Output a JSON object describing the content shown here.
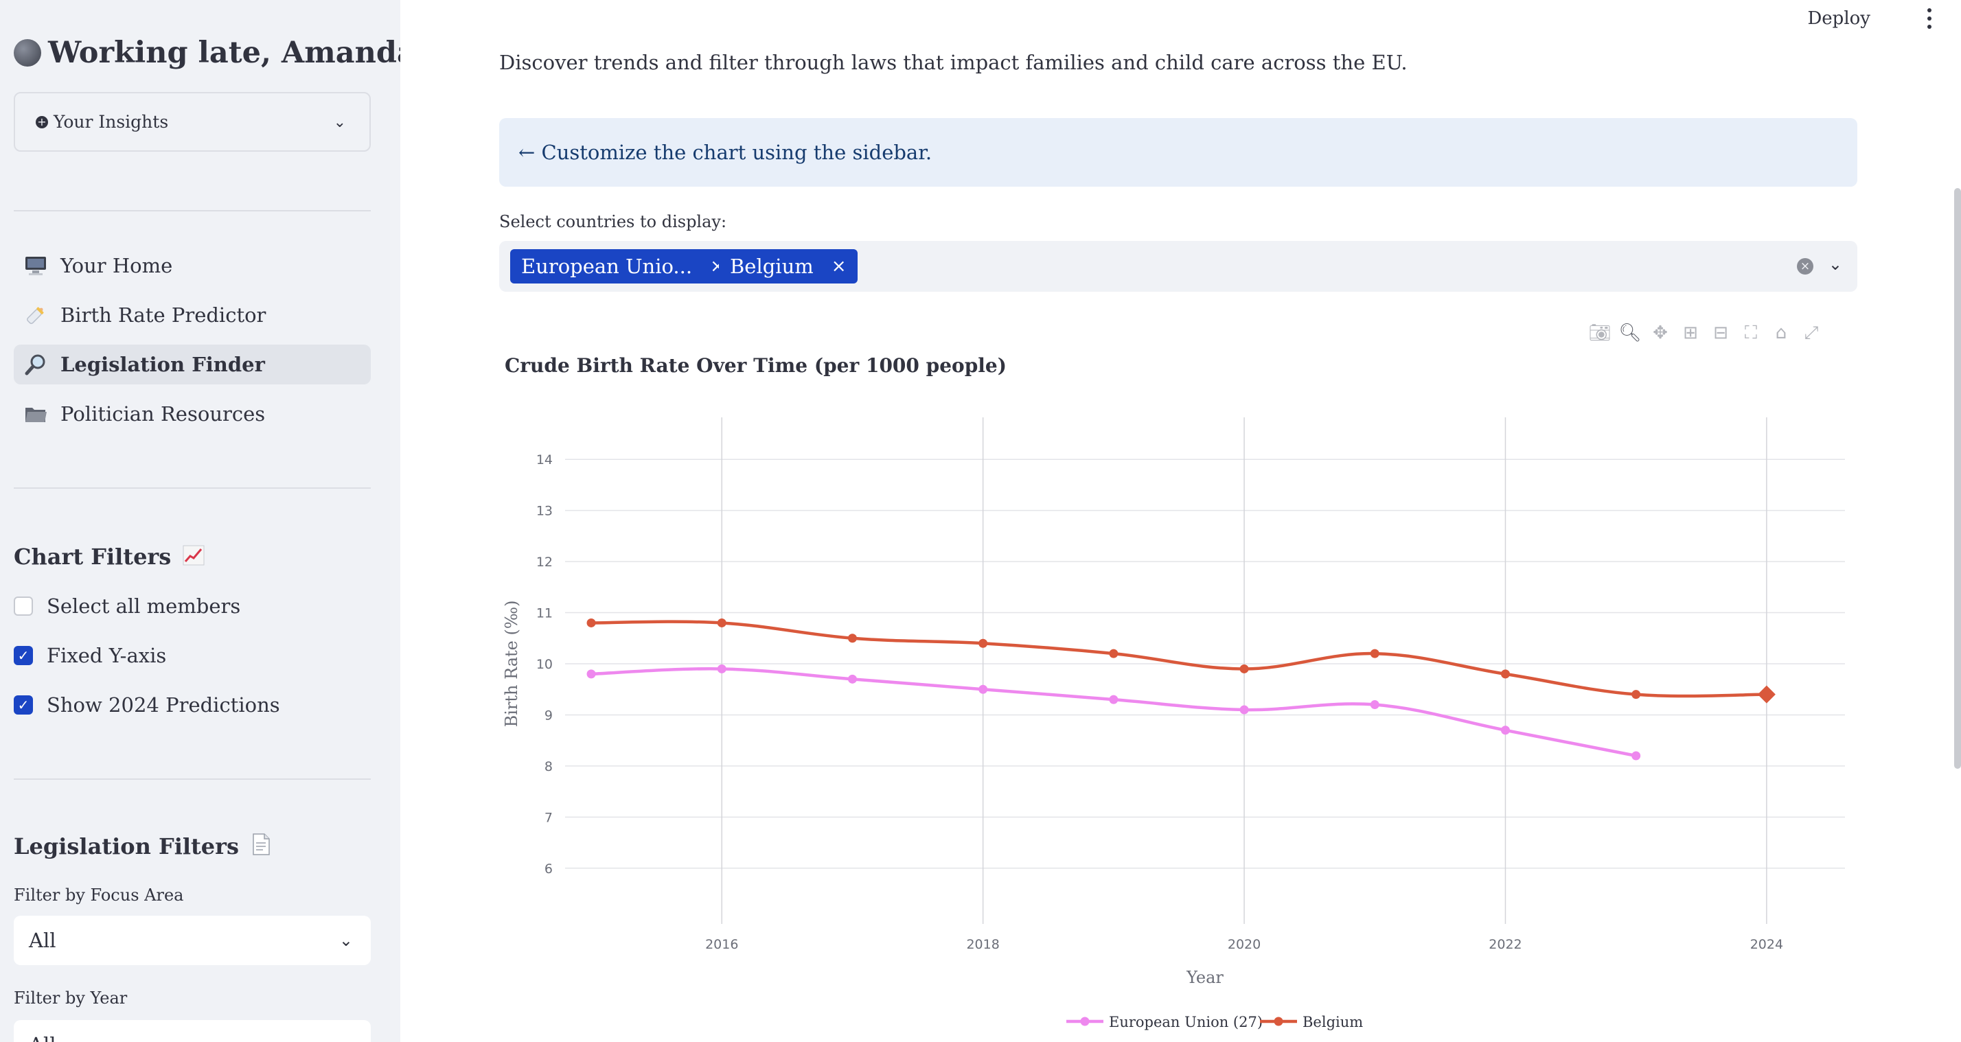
{
  "sidebar": {
    "greeting": "Working late, Amanda!",
    "insights_label": "Your Insights",
    "nav": [
      {
        "label": "Your Home",
        "icon": "monitor-icon",
        "active": false
      },
      {
        "label": "Birth Rate Predictor",
        "icon": "baby-bottle-icon",
        "active": false
      },
      {
        "label": "Legislation Finder",
        "icon": "magnifier-icon",
        "active": true
      },
      {
        "label": "Politician Resources",
        "icon": "folder-icon",
        "active": false
      }
    ],
    "chart_filters": {
      "title": "Chart Filters",
      "select_all": {
        "label": "Select all members",
        "checked": false
      },
      "fixed_y": {
        "label": "Fixed Y-axis",
        "checked": true
      },
      "show_predictions": {
        "label": "Show 2024 Predictions",
        "checked": true
      }
    },
    "legislation_filters": {
      "title": "Legislation Filters",
      "focus_area_label": "Filter by Focus Area",
      "focus_area_value": "All",
      "year_label": "Filter by Year",
      "year_value": "All"
    }
  },
  "header": {
    "deploy_label": "Deploy"
  },
  "main": {
    "intro": "Discover trends and filter through laws that impact families and child care across the EU.",
    "info": "← Customize the chart using the sidebar.",
    "select_label": "Select countries to display:",
    "chips": [
      "European Unio...",
      "Belgium"
    ],
    "chip_close": "×"
  },
  "colors": {
    "accent": "#1a45c4",
    "eu_series": "#ee88ee",
    "belgium_series": "#d9583b"
  },
  "chart_data": {
    "type": "line",
    "title": "Crude Birth Rate Over Time (per 1000 people)",
    "xlabel": "Year",
    "ylabel": "Birth Rate (‰)",
    "xlim": [
      2014.8,
      2024.6
    ],
    "ylim": [
      5.5,
      14.5
    ],
    "xticks": [
      "2016",
      "2018",
      "2020",
      "2022",
      "2024"
    ],
    "yticks": [
      "6",
      "7",
      "8",
      "9",
      "10",
      "11",
      "12",
      "13",
      "14"
    ],
    "legend_position": "bottom-center",
    "series": [
      {
        "name": "European Union (27)",
        "x": [
          2015,
          2016,
          2017,
          2018,
          2019,
          2020,
          2021,
          2022,
          2023
        ],
        "y": [
          9.8,
          9.9,
          9.7,
          9.5,
          9.3,
          9.1,
          9.2,
          8.7,
          8.2
        ]
      },
      {
        "name": "Belgium",
        "x": [
          2015,
          2016,
          2017,
          2018,
          2019,
          2020,
          2021,
          2022,
          2023,
          2024
        ],
        "y": [
          10.8,
          10.8,
          10.5,
          10.4,
          10.2,
          9.9,
          10.2,
          9.8,
          9.4,
          9.4
        ],
        "prediction_year": 2024
      }
    ]
  }
}
